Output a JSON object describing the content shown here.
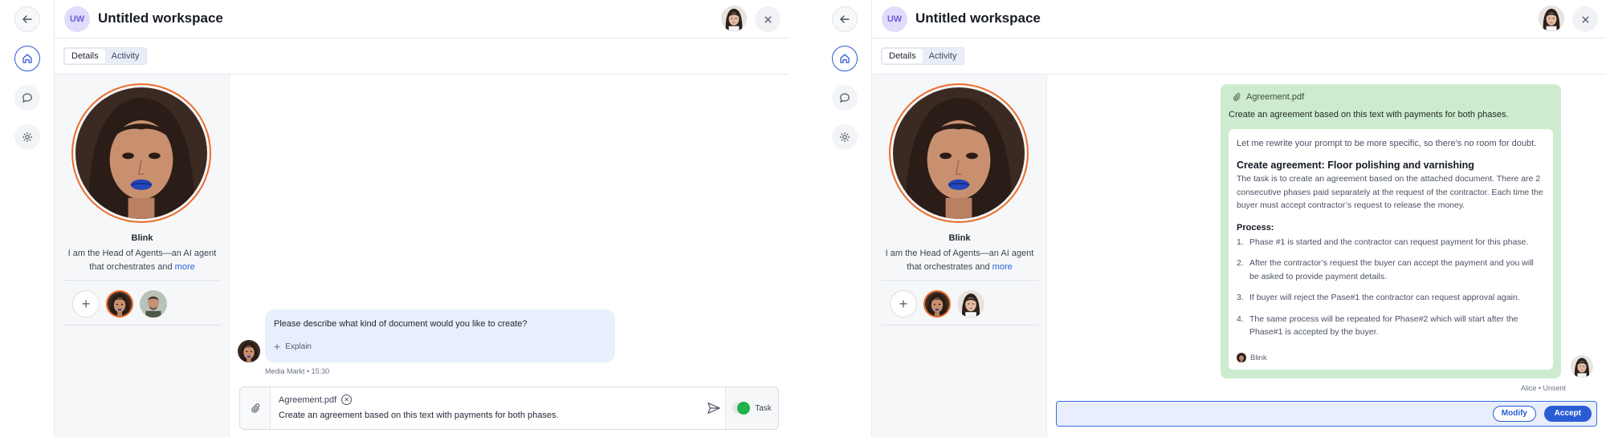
{
  "workspace": {
    "badge": "UW",
    "title": "Untitled workspace"
  },
  "tabs": [
    {
      "label": "Details",
      "active": true
    },
    {
      "label": "Activity",
      "active": false
    }
  ],
  "agent": {
    "name": "Blink",
    "description": "I am the Head of Agents—an AI agent that orchestrates and ",
    "more_label": "more",
    "add_icon": "plus-icon"
  },
  "left_chat": {
    "message": "Please describe what kind of document would you like to create?",
    "explain_label": "Explain",
    "meta": "Media Markt • 15:30",
    "composer": {
      "attachment": "Agreement.pdf",
      "text": "Create an agreement based on this text with payments for both phases.",
      "task_label": "Task",
      "task_enabled": true
    }
  },
  "right_chat": {
    "attachment": "Agreement.pdf",
    "prompt": "Create an agreement based on this text with payments for both phases.",
    "rewrite_intro": "Let me rewrite your prompt to be more specific, so there's no room for doubt.",
    "agreement_title": "Create agreement: Floor polishing and varnishing",
    "agreement_body": "The task is to create an agreement based on the attached document. There are 2 consecutive phases paid separately at the request of the contractor. Each time the buyer must accept contractor’s request to release the money.",
    "process_heading": "Process:",
    "steps": [
      {
        "n": "1.",
        "text": "Phase #1 is started and the contractor can request payment for this phase."
      },
      {
        "n": "2.",
        "text": "After the contractor’s request the buyer can accept the payment and you will be asked to provide payment details."
      },
      {
        "n": "3.",
        "text": "If buyer will reject the Pase#1 the contractor can request approval again."
      },
      {
        "n": "4.",
        "text": "The same process will be repeated for Phase#2 which will start after the Phase#1 is accepted by the buyer."
      }
    ],
    "signature": "Blink",
    "meta": "Alice • Unsent",
    "modify_label": "Modify",
    "accept_label": "Accept"
  },
  "colors": {
    "accent": "#2a5cd6",
    "agent_ring": "#ec6b2a",
    "bubble": "#e8eefb",
    "green_card": "#cdeccf",
    "toggle_on": "#22b24c"
  }
}
